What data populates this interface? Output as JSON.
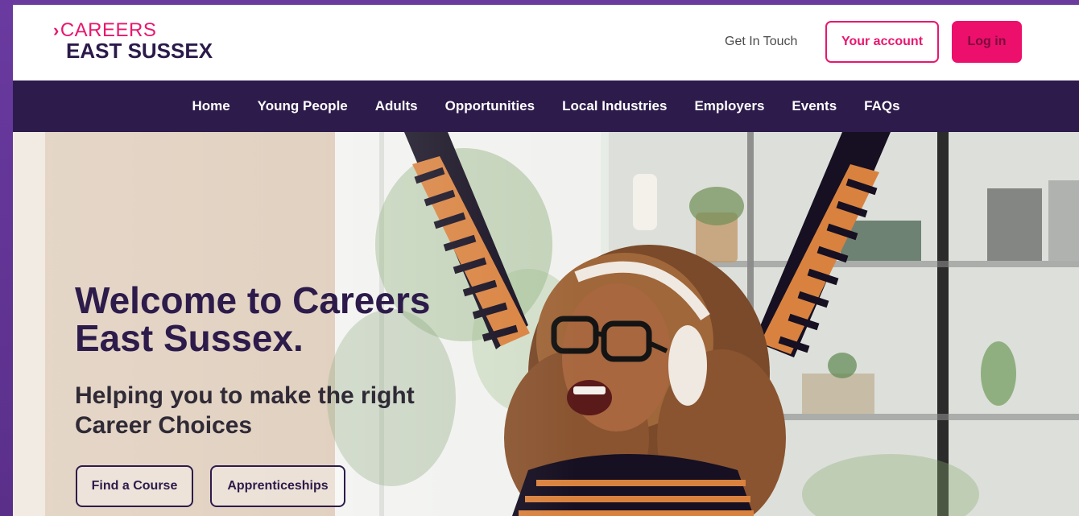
{
  "brand": {
    "logo_line1": "CAREERS",
    "logo_line2": "EAST SUSSEX",
    "colors": {
      "pink": "#e8176f",
      "purple": "#2d1b4b",
      "frame": "#6b3b9e"
    }
  },
  "header": {
    "get_in_touch": "Get In Touch",
    "account_label": "Your account",
    "login_label": "Log in"
  },
  "nav": {
    "items": [
      "Home",
      "Young People",
      "Adults",
      "Opportunities",
      "Local Industries",
      "Employers",
      "Events",
      "FAQs"
    ]
  },
  "hero": {
    "title_line1": "Welcome to Careers",
    "title_line2": "East Sussex.",
    "subtitle_line1": "Helping you to make the right",
    "subtitle_line2": "Career Choices",
    "buttons": [
      "Find a Course",
      "Apprenticeships"
    ]
  }
}
